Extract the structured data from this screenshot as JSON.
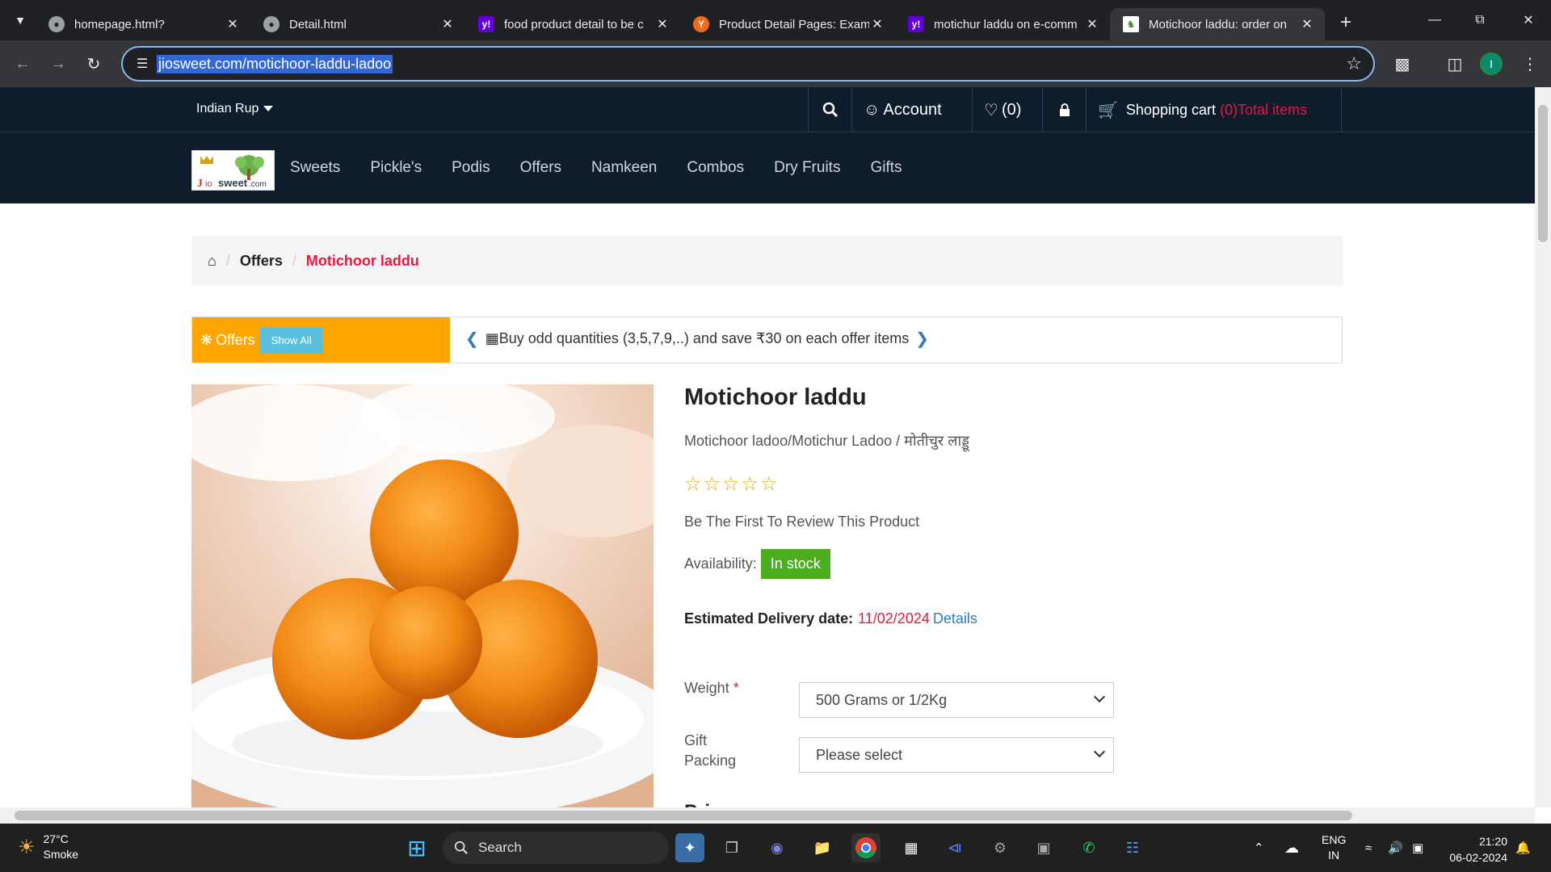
{
  "browser": {
    "tabs": [
      {
        "label": "homepage.html?",
        "favicon": "globe-icon",
        "active": false
      },
      {
        "label": "Detail.html",
        "favicon": "globe-icon",
        "active": false
      },
      {
        "label": "food product detail to be c",
        "favicon": "yahoo-icon",
        "active": false
      },
      {
        "label": "Product Detail Pages: Exam",
        "favicon": "y-combinator-icon",
        "active": false
      },
      {
        "label": "motichur laddu on e-comm",
        "favicon": "yahoo-icon",
        "active": false
      },
      {
        "label": "Motichoor laddu: order on",
        "favicon": "site-icon",
        "active": true
      }
    ],
    "url": "jiosweet.com/motichoor-laddu-ladoo",
    "profile_initial": "I"
  },
  "site": {
    "currency": "Indian Rup",
    "account_label": "Account",
    "wishlist_count": "(0)",
    "cart_label": "Shopping cart",
    "cart_count": "(0)Total items",
    "logo_text": "Jio sweet.com",
    "nav": [
      "Sweets",
      "Pickle's",
      "Podis",
      "Offers",
      "Namkeen",
      "Combos",
      "Dry Fruits",
      "Gifts"
    ]
  },
  "breadcrumb": {
    "parent": "Offers",
    "current": "Motichoor laddu"
  },
  "offers": {
    "label": "Offers",
    "show_all": "Show All",
    "message": "Buy odd quantities (3,5,7,9,..) and save ₹30 on each offer items"
  },
  "product": {
    "title": "Motichoor laddu",
    "subtitle": "Motichoor ladoo/Motichur Ladoo / मोतीचुर लाड्डू",
    "rating": 0,
    "review_prompt": "Be The First To Review This Product",
    "availability_label": "Availability:",
    "availability_value": "In stock",
    "delivery_label": "Estimated Delivery date:",
    "delivery_date": "11/02/2024",
    "delivery_details": "Details",
    "weight_label": "Weight",
    "weight_value": "500 Grams or 1/2Kg",
    "gift_label_line1": "Gift",
    "gift_label_line2": "Packing",
    "gift_value": "Please select",
    "price_partial": "Pri"
  },
  "taskbar": {
    "temperature": "27°C",
    "weather": "Smoke",
    "search": "Search",
    "lang_line1": "ENG",
    "lang_line2": "IN",
    "time": "21:20",
    "date": "06-02-2024"
  }
}
